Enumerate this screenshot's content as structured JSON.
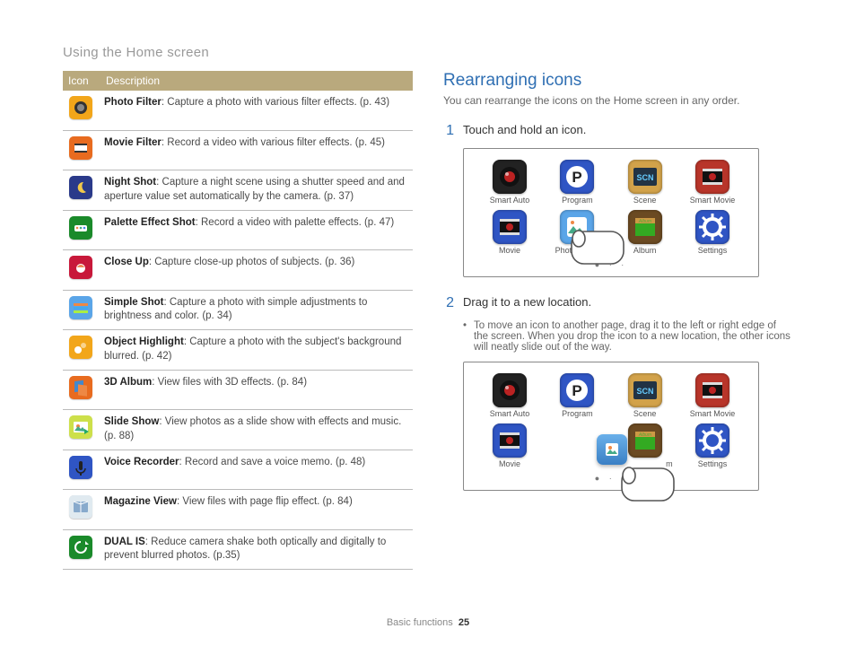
{
  "header": {
    "title": "Using the Home screen"
  },
  "table": {
    "col_icon": "Icon",
    "col_desc": "Description",
    "rows": [
      {
        "name": "Photo Filter",
        "rest": ": Capture a photo with various filter effects. (p. 43)",
        "icon": "photo-filter",
        "bg": "#f2a61a"
      },
      {
        "name": "Movie Filter",
        "rest": ": Record a video with various filter effects. (p. 45)",
        "icon": "movie-filter",
        "bg": "#e86b1f"
      },
      {
        "name": "Night Shot",
        "rest": ": Capture a night scene using a shutter speed and and aperture value set automatically by the camera. (p. 37)",
        "icon": "night-shot",
        "bg": "#2a3a8a"
      },
      {
        "name": "Palette Effect Shot",
        "rest": ": Record a video with palette effects. (p. 47)",
        "icon": "palette",
        "bg": "#1a8a2a"
      },
      {
        "name": "Close Up",
        "rest": ": Capture close-up photos of subjects. (p. 36)",
        "icon": "close-up",
        "bg": "#c8183a"
      },
      {
        "name": "Simple Shot",
        "rest": ": Capture a photo with simple adjustments to brightness and color. (p. 34)",
        "icon": "simple-shot",
        "bg": "#5aa5e8"
      },
      {
        "name": "Object Highlight",
        "rest": ": Capture a photo with the subject's background blurred. (p. 42)",
        "icon": "object-highlight",
        "bg": "#f2a61a"
      },
      {
        "name": "3D Album",
        "rest": ": View files with 3D effects. (p. 84)",
        "icon": "album-3d",
        "bg": "#e86b1f"
      },
      {
        "name": "Slide Show",
        "rest": ": View photos as a slide show with effects and music. (p. 88)",
        "icon": "slide-show",
        "bg": "#cde04a"
      },
      {
        "name": "Voice Recorder",
        "rest": ": Record and save a voice memo. (p. 48)",
        "icon": "voice-recorder",
        "bg": "#2f55c4"
      },
      {
        "name": "Magazine View",
        "rest": ": View files with page flip effect. (p. 84)",
        "icon": "magazine-view",
        "bg": "#e0eaf0"
      },
      {
        "name": "DUAL IS",
        "rest": ": Reduce camera shake both optically and digitally to prevent blurred photos. (p.35)",
        "icon": "dual-is",
        "bg": "#1a8a2a"
      }
    ]
  },
  "right": {
    "title": "Rearranging icons",
    "lede": "You can rearrange the icons on the Home screen in any order.",
    "step1_num": "1",
    "step1_text": "Touch and hold an icon.",
    "step2_num": "2",
    "step2_text": "Drag it to a new location.",
    "bullet_text": "To move an icon to another page, drag it to the left or right edge of the screen. When you drop the icon to a new location, the other icons will neatly slide out of the way."
  },
  "screen": {
    "items_row1": [
      {
        "label": "Smart Auto",
        "icon": "smart-auto",
        "bg": "#222",
        "glyph": "lens-red"
      },
      {
        "label": "Program",
        "icon": "program",
        "bg": "#2f55c4",
        "glyph": "P"
      },
      {
        "label": "Scene",
        "icon": "scene",
        "bg": "#d2a24a",
        "glyph": "SCN"
      },
      {
        "label": "Smart Movie",
        "icon": "smart-movie",
        "bg": "#b8352a",
        "glyph": "film"
      }
    ],
    "items_row2_a": [
      {
        "label": "Movie",
        "icon": "movie",
        "bg": "#2f55c4",
        "glyph": "film"
      },
      {
        "label": "Photo Editor",
        "icon": "photo-editor",
        "bg": "#5aa5e8",
        "glyph": "palette",
        "overlap": true
      },
      {
        "label": "Album",
        "icon": "album",
        "bg": "#6b4a22",
        "glyph": "album"
      },
      {
        "label": "Settings",
        "icon": "settings",
        "bg": "#2f55c4",
        "glyph": "gear"
      }
    ],
    "items_row2_b": [
      {
        "label": "Movie",
        "icon": "movie",
        "bg": "#2f55c4",
        "glyph": "film"
      },
      {
        "label": "",
        "icon": "photo-editor-drag",
        "bg": "transparent",
        "glyph": "drag"
      },
      {
        "label": "Album",
        "icon": "album",
        "bg": "#6b4a22",
        "glyph": "album",
        "short": "m"
      },
      {
        "label": "Settings",
        "icon": "settings",
        "bg": "#2f55c4",
        "glyph": "gear"
      }
    ],
    "pager": "●  ·  ·"
  },
  "footer": {
    "section": "Basic functions",
    "page": "25"
  }
}
